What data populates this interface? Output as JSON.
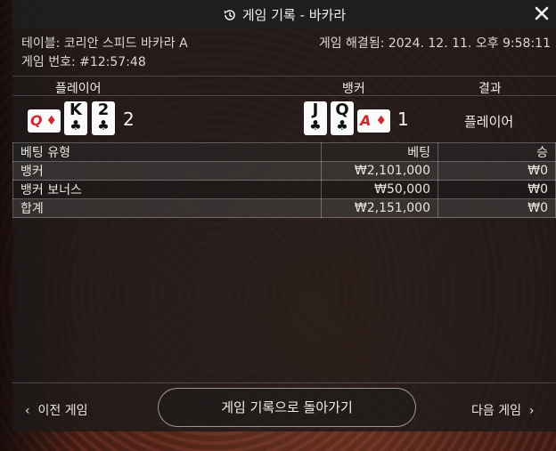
{
  "header": {
    "title": "게임 기록 - 바카라",
    "icon": "history-icon",
    "close_icon": "close-icon"
  },
  "info": {
    "table": "테이블: 코리안 스피드 바카라 A",
    "game_no": "게임 번호: #12:57:48",
    "resolved": "게임 해결됨: 2024. 12. 11. 오후 9:58:11"
  },
  "columns": {
    "player": "플레이어",
    "banker": "뱅커",
    "result": "결과"
  },
  "hands": {
    "player": {
      "side_card": {
        "rank": "Q",
        "suit": "♦"
      },
      "cards": [
        {
          "rank": "K",
          "suit": "♣"
        },
        {
          "rank": "2",
          "suit": "♣"
        }
      ],
      "score": "2"
    },
    "banker": {
      "cards": [
        {
          "rank": "J",
          "suit": "♣"
        },
        {
          "rank": "Q",
          "suit": "♣"
        }
      ],
      "side_card": {
        "rank": "A",
        "suit": "♦"
      },
      "score": "1"
    },
    "result": "플레이어"
  },
  "bets": {
    "headers": [
      "베팅 유형",
      "베팅",
      "승"
    ],
    "rows": [
      [
        "뱅커",
        "₩2,101,000",
        "₩0"
      ],
      [
        "뱅커 보너스",
        "₩50,000",
        "₩0"
      ],
      [
        "합계",
        "₩2,151,000",
        "₩0"
      ]
    ]
  },
  "footer": {
    "prev": "이전 게임",
    "back": "게임 기록으로 돌아가기",
    "next": "다음 게임"
  },
  "colors": {
    "red_suit": "#d0282f",
    "panel": "#1c1a1a"
  }
}
